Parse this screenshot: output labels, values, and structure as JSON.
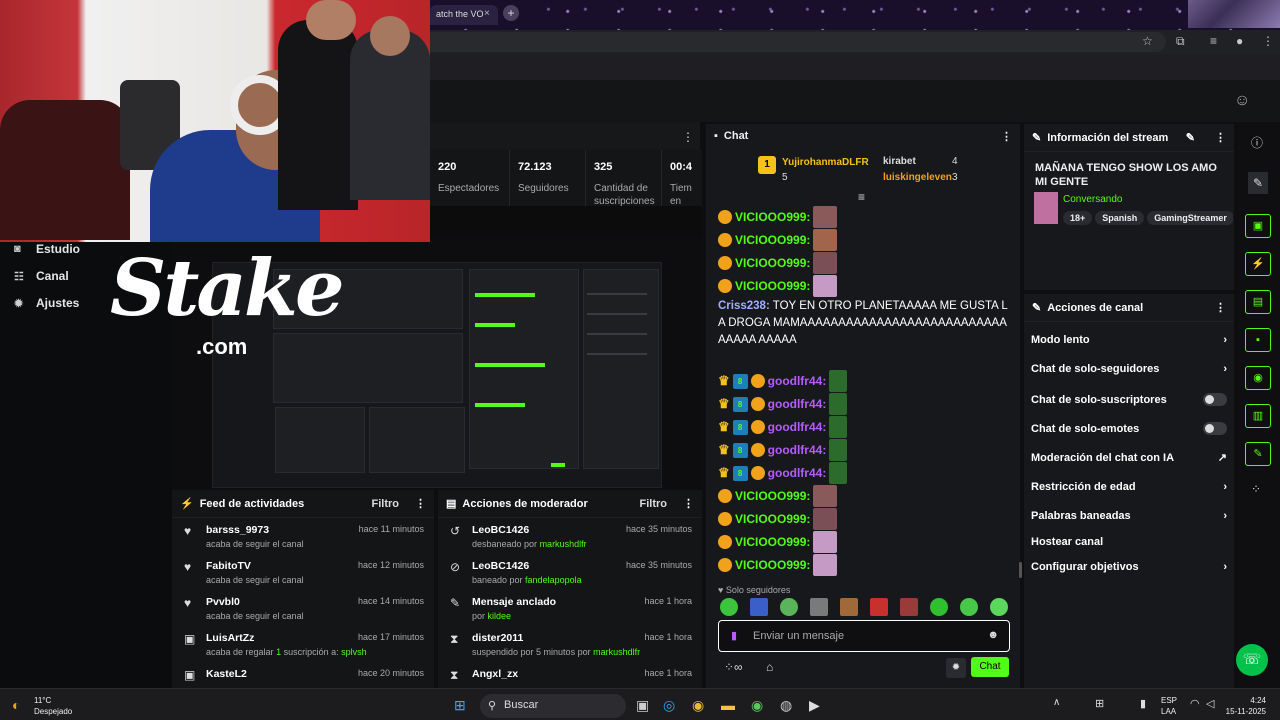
{
  "browser": {
    "tab_title": "atch the VO",
    "tab_close": "×",
    "new_tab": "+"
  },
  "nav": {
    "items": [
      {
        "label": "Estudio",
        "icon": "camera-icon"
      },
      {
        "label": "Canal",
        "icon": "users-icon"
      },
      {
        "label": "Ajustes",
        "icon": "gear-icon"
      }
    ]
  },
  "overlay": {
    "logo": "Stake",
    "logo_sub": ".com"
  },
  "stats": [
    {
      "value": "220",
      "label": "Espectadores"
    },
    {
      "value": "72.123",
      "label": "Seguidores"
    },
    {
      "value": "325",
      "label": "Cantidad de suscripciones"
    },
    {
      "value": "00:4",
      "label": "Tiem en vi"
    }
  ],
  "feed": {
    "title": "Feed de actividades",
    "filter": "Filtro",
    "rows": [
      {
        "user": "barsss_9973",
        "desc": "acaba de seguir el canal",
        "time": "hace 11 minutos",
        "icon": "heart-icon"
      },
      {
        "user": "FabitoTV",
        "desc": "acaba de seguir el canal",
        "time": "hace 12 minutos",
        "icon": "heart-icon"
      },
      {
        "user": "Pvvbl0",
        "desc": "acaba de seguir el canal",
        "time": "hace 14 minutos",
        "icon": "heart-icon"
      },
      {
        "user": "LuisArtZz",
        "desc": "acaba de regalar ",
        "count": "1",
        "desc2": " suscripción a: ",
        "target": "splvsh",
        "time": "hace 17 minutos",
        "icon": "gift-icon"
      },
      {
        "user": "KasteL2",
        "desc": "",
        "time": "hace 20 minutos",
        "icon": "gift-icon"
      }
    ]
  },
  "mod": {
    "title": "Acciones de moderador",
    "filter": "Filtro",
    "rows": [
      {
        "user": "LeoBC1426",
        "desc": "desbaneado por ",
        "by": "markushdlfr",
        "time": "hace 35 minutos",
        "icon": "undo-icon"
      },
      {
        "user": "LeoBC1426",
        "desc": "baneado por ",
        "by": "fandelapopola",
        "time": "hace 35 minutos",
        "icon": "ban-icon"
      },
      {
        "user": "Mensaje anclado",
        "desc": "por ",
        "by": "kildee",
        "time": "hace 1 hora",
        "icon": "pin-icon"
      },
      {
        "user": "dister2011",
        "desc": "suspendido por 5 minutos por ",
        "by": "markushdlfr",
        "time": "hace 1 hora",
        "icon": "hourglass-icon"
      },
      {
        "user": "Angxl_zx",
        "desc": "",
        "by": "",
        "time": "hace 1 hora",
        "icon": "hourglass-icon"
      }
    ]
  },
  "chat": {
    "title": "Chat",
    "leader": {
      "top_name": "YujirohanmaDLFR",
      "top_rank": "1",
      "top_count": "5",
      "second": "kirabet",
      "second_count": "4",
      "third": "luiskingeleven",
      "third_count": "3"
    },
    "messages": [
      {
        "user": "VICIOOO999:"
      },
      {
        "user": "VICIOOO999:"
      },
      {
        "user": "VICIOOO999:"
      },
      {
        "user": "VICIOOO999:"
      }
    ],
    "long_msg": {
      "user": "Criss238:",
      "text": " TOY EN OTRO PLANETAAAAA ME GUSTA LA DROGA MAMAAAAAAAAAAAAAAAAAAAAAAAAAAAAAAAA AAAAA"
    },
    "good": [
      "goodlfr44:",
      "goodlfr44:",
      "goodlfr44:",
      "goodlfr44:",
      "goodlfr44:"
    ],
    "vic2": [
      "VICIOOO999:",
      "VICIOOO999:",
      "VICIOOO999:",
      "VICIOOO999:"
    ],
    "mode": "Solo seguidores",
    "placeholder": "Enviar un mensaje",
    "send": "Chat"
  },
  "info": {
    "title": "Información del stream",
    "stream_title": "MAÑANA TENGO SHOW LOS AMO MI GENTE",
    "category": "Conversando",
    "tags": [
      "18+",
      "Spanish",
      "GamingStreamer"
    ]
  },
  "actions": {
    "title": "Acciones de canal",
    "items": [
      {
        "label": "Modo lento",
        "ctrl": "chevron"
      },
      {
        "label": "Chat de solo-seguidores",
        "ctrl": "chevron"
      },
      {
        "label": "Chat de solo-suscriptores",
        "ctrl": "toggle"
      },
      {
        "label": "Chat de solo-emotes",
        "ctrl": "toggle"
      },
      {
        "label": "Moderación del chat con IA",
        "ctrl": "external"
      },
      {
        "label": "Restricción de edad",
        "ctrl": "chevron"
      },
      {
        "label": "Palabras baneadas",
        "ctrl": "chevron"
      },
      {
        "label": "Hostear canal",
        "ctrl": "none"
      },
      {
        "label": "Configurar objetivos",
        "ctrl": "chevron"
      }
    ]
  },
  "taskbar": {
    "weather_temp": "11°C",
    "weather_desc": "Despejado",
    "search": "Buscar",
    "lang": "ESP",
    "lang2": "LAA",
    "time": "4:24",
    "date": "15-11-2025"
  },
  "colors": {
    "accent": "#53fc18",
    "bg": "#0e0e10",
    "panel": "#141517"
  }
}
